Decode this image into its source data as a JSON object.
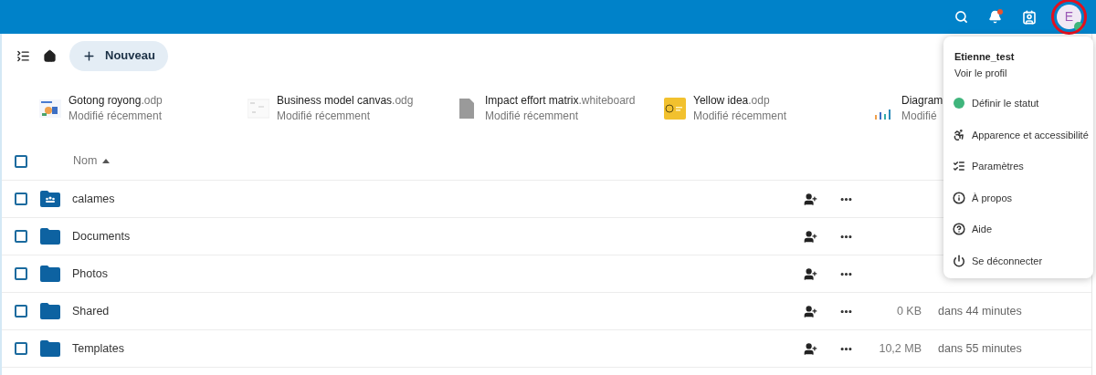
{
  "header": {
    "avatar_letter": "E",
    "avatar_status": {
      "color": "#3fb57c"
    }
  },
  "toolbar": {
    "new_button": "Nouveau"
  },
  "recent": [
    {
      "name": "Gotong royong",
      "ext": ".odp",
      "subtitle": "Modifié récemment",
      "kind": "slides"
    },
    {
      "name": "Business model canvas",
      "ext": ".odg",
      "subtitle": "Modifié récemment",
      "kind": "canvas"
    },
    {
      "name": "Impact effort matrix",
      "ext": ".whiteboard",
      "subtitle": "Modifié récemment",
      "kind": "file"
    },
    {
      "name": "Yellow idea",
      "ext": ".odp",
      "subtitle": "Modifié récemment",
      "kind": "yellow"
    },
    {
      "name": "Diagram",
      "subtitle": "Modifié",
      "kind": "chart"
    }
  ],
  "table": {
    "select_all": {
      "checked": false
    },
    "columns": [
      {
        "label": "Nom",
        "sorted": true
      }
    ],
    "rows": [
      {
        "name": "calames",
        "kind": "shared",
        "checked": false
      },
      {
        "name": "Documents",
        "kind": "folder",
        "checked": false
      },
      {
        "name": "Photos",
        "kind": "folder",
        "checked": false
      },
      {
        "name": "Shared",
        "kind": "folder",
        "checked": false,
        "size": "0 KB",
        "modified": "dans 44 minutes"
      },
      {
        "name": "Templates",
        "kind": "folder",
        "checked": false,
        "size": "10,2 MB",
        "modified": "dans 55 minutes"
      }
    ]
  },
  "user_menu": {
    "username": "Etienne_test",
    "profile_link": "Voir le profil",
    "items": [
      {
        "label": "Définir le statut",
        "kind": "status",
        "color": "#3fb57c"
      },
      {
        "label": "Apparence et accessibilité",
        "kind": "accessibility"
      },
      {
        "label": "Paramètres",
        "kind": "settings"
      },
      {
        "label": "À propos",
        "kind": "info"
      },
      {
        "label": "Aide",
        "kind": "help"
      },
      {
        "label": "Se déconnecter",
        "kind": "logout"
      }
    ]
  }
}
